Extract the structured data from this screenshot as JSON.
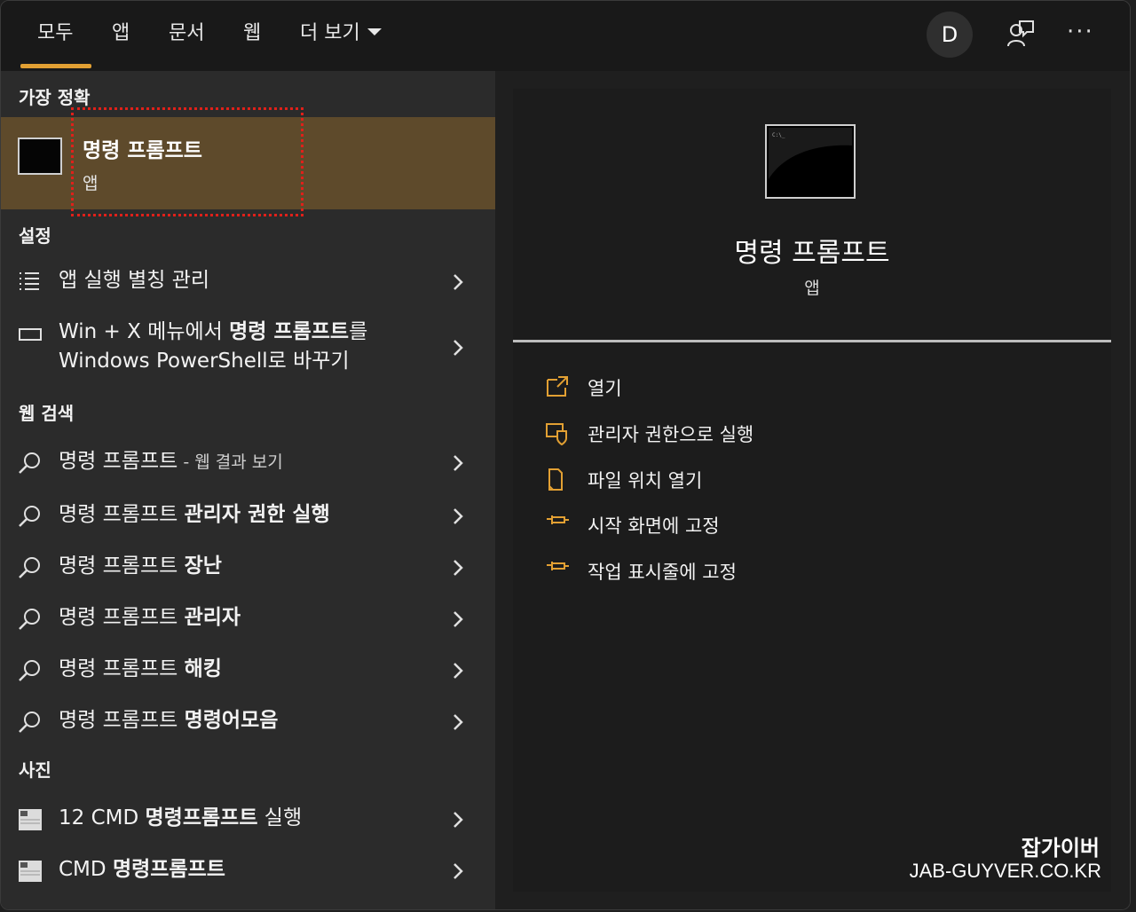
{
  "tabs": [
    {
      "label": "모두"
    },
    {
      "label": "앱"
    },
    {
      "label": "문서"
    },
    {
      "label": "웹"
    },
    {
      "label": "더 보기"
    }
  ],
  "avatar": {
    "initial": "D"
  },
  "sections": {
    "best_match": "가장 정확",
    "settings": "설정",
    "web": "웹 검색",
    "photos": "사진"
  },
  "best": {
    "title": "명령 프롬프트",
    "subtitle": "앱"
  },
  "settings_items": [
    {
      "label": "앱 실행 별칭 관리"
    },
    {
      "line1_pre": "Win + X 메뉴에서 ",
      "line1_bold": "명령 프롬프트",
      "line1_post": "를",
      "line2": "Windows PowerShell로 바꾸기"
    }
  ],
  "web_items": [
    {
      "base": "명령 프롬프트",
      "suffix": " - 웹 결과 보기"
    },
    {
      "base": "명령 프롬프트 ",
      "bold": "관리자 권한 실행"
    },
    {
      "base": "명령 프롬프트 ",
      "bold": "장난"
    },
    {
      "base": "명령 프롬프트 ",
      "bold": "관리자"
    },
    {
      "base": "명령 프롬프트 ",
      "bold": "해킹"
    },
    {
      "base": "명령 프롬프트 ",
      "bold": "명령어모음"
    }
  ],
  "photo_items": [
    {
      "base": "12 CMD ",
      "bold": "명령프롬프트",
      "post": " 실행"
    },
    {
      "base": "CMD ",
      "bold": "명령프롬프트",
      "post": ""
    }
  ],
  "detail": {
    "title": "명령 프롬프트",
    "subtitle": "앱",
    "actions": [
      {
        "label": "열기",
        "icon": "open-icon"
      },
      {
        "label": "관리자 권한으로 실행",
        "icon": "shield-icon"
      },
      {
        "label": "파일 위치 열기",
        "icon": "file-location-icon"
      },
      {
        "label": "시작 화면에 고정",
        "icon": "pin-icon"
      },
      {
        "label": "작업 표시줄에 고정",
        "icon": "pin-icon"
      }
    ]
  },
  "watermark": {
    "line1": "잡가이버",
    "line2": "JAB-GUYVER.CO.KR"
  },
  "colors": {
    "accent": "#e2a033",
    "selected_row": "#5e4a2b",
    "focus_outline": "#e0201a"
  }
}
